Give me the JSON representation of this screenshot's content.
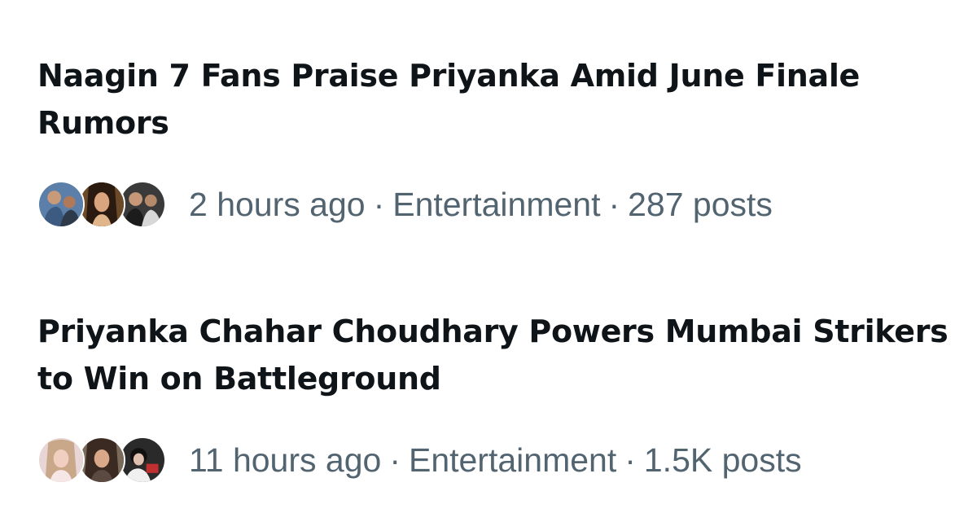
{
  "trends": [
    {
      "headline": "Naagin 7 Fans Praise Priyanka Amid June Finale Rumors",
      "time": "2 hours ago",
      "category": "Entertainment",
      "posts": "287 posts",
      "separator": "·",
      "avatars": [
        "avatar-photo",
        "avatar-photo",
        "avatar-photo"
      ]
    },
    {
      "headline": "Priyanka Chahar Choudhary Powers Mumbai Strikers to Win on Battleground",
      "time": "11 hours ago",
      "category": "Entertainment",
      "posts": "1.5K posts",
      "separator": "·",
      "avatars": [
        "avatar-photo",
        "avatar-photo",
        "avatar-photo"
      ]
    }
  ],
  "colors": {
    "headline": "#0f1419",
    "meta": "#536471",
    "background": "#ffffff"
  }
}
